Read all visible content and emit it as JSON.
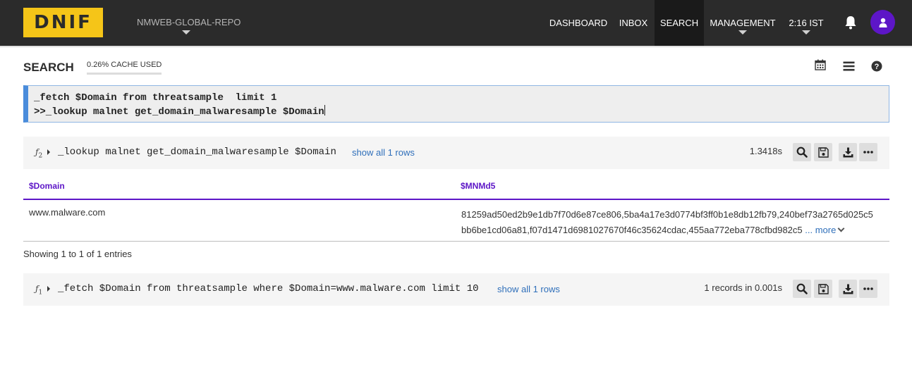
{
  "nav": {
    "logo": "DNIF",
    "repo": "NMWEB-GLOBAL-REPO",
    "items": [
      "DASHBOARD",
      "INBOX",
      "SEARCH",
      "MANAGEMENT"
    ],
    "time": "2:16 IST",
    "icons": [
      "bell-icon",
      "user-icon"
    ],
    "accent": "#5d16c7",
    "logo_color": "#f5c518"
  },
  "search": {
    "title": "SEARCH",
    "cache": "0.26% CACHE USED",
    "toolbar_icons": [
      "calendar-icon",
      "list-icon",
      "help-icon"
    ],
    "query_lines": [
      "_fetch $Domain from threatsample  limit 1",
      ">>_lookup malnet get_domain_malwaresample $Domain"
    ]
  },
  "result2": {
    "fn_label": "ƒ",
    "fn_index": "2",
    "command": "_lookup malnet get_domain_malwaresample $Domain",
    "show_all": "show all 1 rows",
    "timing": "1.3418s",
    "columns": [
      "$Domain",
      "$MNMd5"
    ],
    "rows": [
      {
        "domain": "www.malware.com",
        "md5_line1": "81259ad50ed2b9e1db7f70d6e87ce806,5ba4a17e3d0774bf3ff0b1e8db12fb79,240bef73a2765d025c5",
        "md5_line2": "bb6be1cd06a81,f07d1471d6981027670f46c35624cdac,455aa772eba778cfbd982c5",
        "more": "... more"
      }
    ],
    "showing": "Showing 1 to 1 of 1 entries"
  },
  "result1": {
    "fn_label": "ƒ",
    "fn_index": "1",
    "command": "_fetch $Domain from threatsample where $Domain=www.malware.com limit 10",
    "show_all": "show all 1 rows",
    "timing": "1 records in 0.001s"
  }
}
